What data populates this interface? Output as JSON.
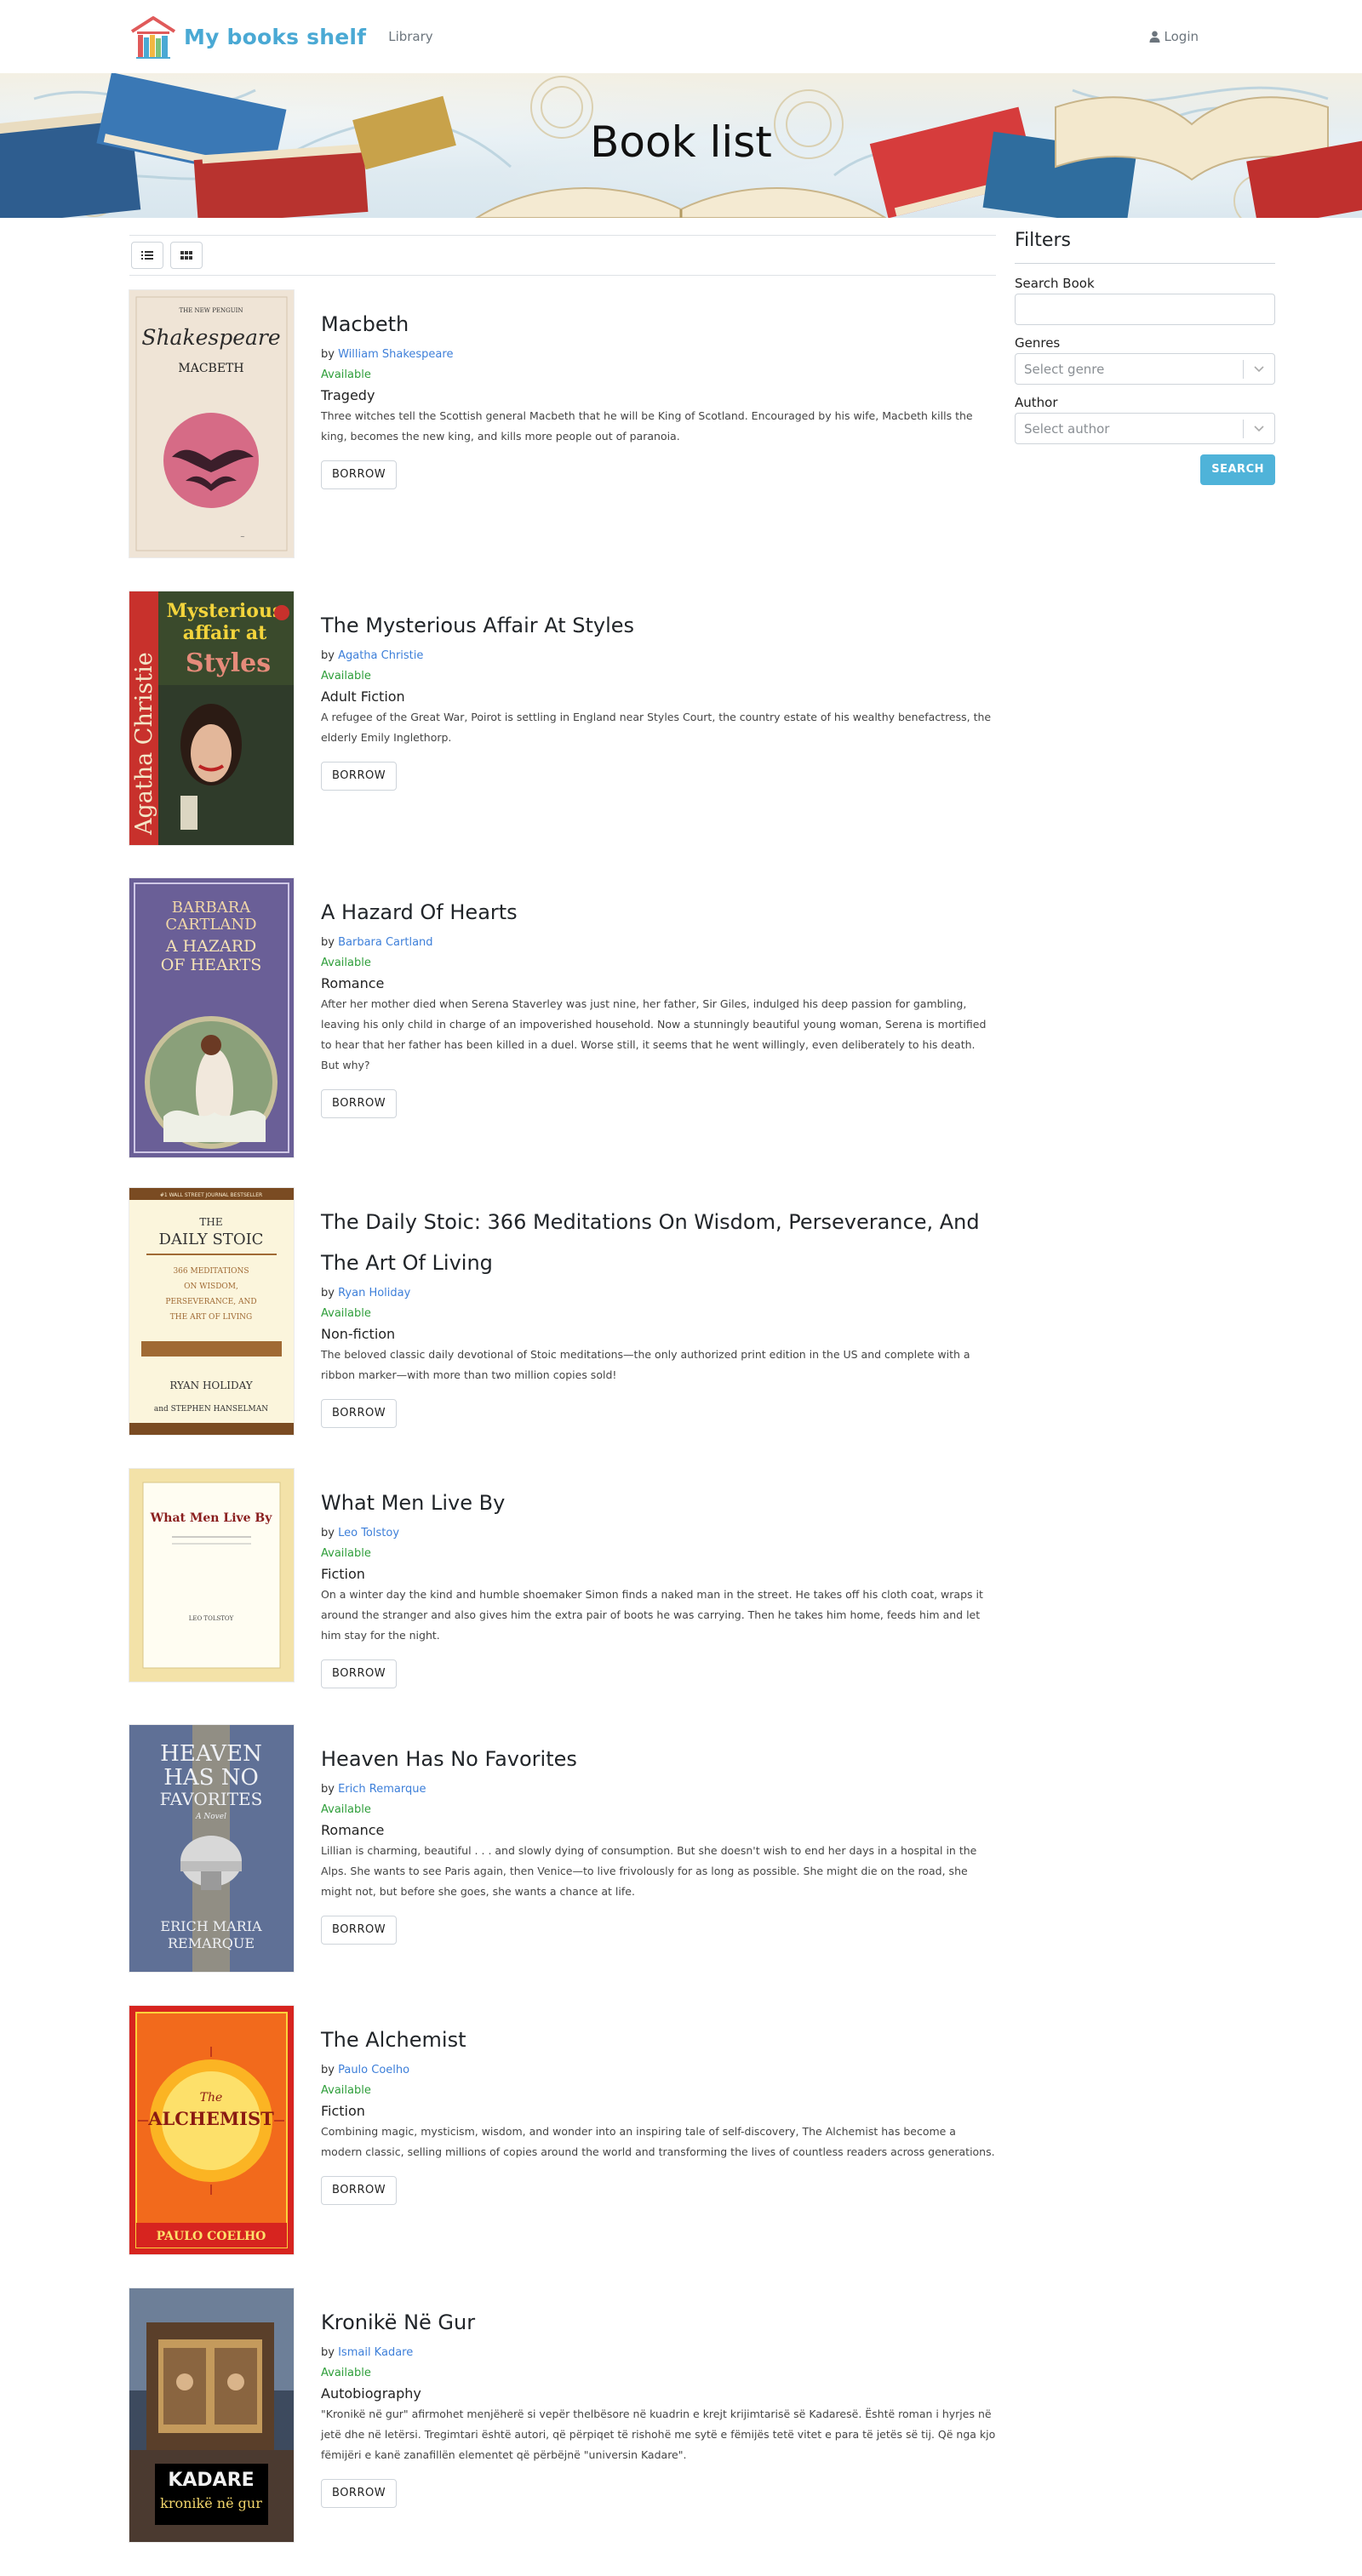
{
  "nav": {
    "brand": "My books shelf",
    "library": "Library",
    "login": "Login"
  },
  "hero": {
    "title": "Book list"
  },
  "sidebar": {
    "title": "Filters",
    "search_label": "Search Book",
    "genres_label": "Genres",
    "genre_placeholder": "Select genre",
    "author_label": "Author",
    "author_placeholder": "Select author",
    "search_button": "SEARCH"
  },
  "books": [
    {
      "title": "Macbeth",
      "by": "by",
      "author": "William Shakespeare",
      "status": "Available",
      "genre": "Tragedy",
      "description": "Three witches tell the Scottish general Macbeth that he will be King of Scotland. Encouraged by his wife, Macbeth kills the king, becomes the new king, and kills more people out of paranoia.",
      "borrow": "BORROW",
      "cover_text": [
        "THE NEW PENGUIN",
        "Shakespeare",
        "MACBETH"
      ]
    },
    {
      "title": "The Mysterious Affair At Styles",
      "by": "by",
      "author": "Agatha Christie",
      "status": "Available",
      "genre": "Adult Fiction",
      "description": "A refugee of the Great War, Poirot is settling in England near Styles Court, the country estate of his wealthy benefactress, the elderly Emily Inglethorp.",
      "borrow": "BORROW",
      "cover_text": [
        "Agatha Christie",
        "Mysterious",
        "affair at",
        "Styles"
      ]
    },
    {
      "title": "A Hazard Of Hearts",
      "by": "by",
      "author": "Barbara Cartland",
      "status": "Available",
      "genre": "Romance",
      "description": "After her mother died when Serena Staverley was just nine, her father, Sir Giles, indulged his deep passion for gambling, leaving his only child in charge of an impoverished household. Now a stunningly beautiful young woman, Serena is mortified to hear that her father has been killed in a duel. Worse still, it seems that he went willingly, even deliberately to his death. But why?",
      "borrow": "BORROW",
      "cover_text": [
        "BARBARA",
        "CARTLAND",
        "A HAZARD",
        "OF HEARTS"
      ]
    },
    {
      "title": "The Daily Stoic: 366 Meditations On Wisdom, Perseverance, And The Art Of Living",
      "by": "by",
      "author": "Ryan Holiday",
      "status": "Available",
      "genre": "Non-fiction",
      "description": "The beloved classic daily devotional of Stoic meditations—the only authorized print edition in the US and complete with a ribbon marker—with more than two million copies sold!",
      "borrow": "BORROW",
      "cover_text": [
        "#1 WALL STREET JOURNAL BESTSELLER",
        "THE",
        "DAILY STOIC",
        "366 MEDITATIONS",
        "ON WISDOM,",
        "PERSEVERANCE, AND",
        "THE ART OF LIVING",
        "RYAN HOLIDAY",
        "and STEPHEN HANSELMAN"
      ]
    },
    {
      "title": "What Men Live By",
      "by": "by",
      "author": "Leo Tolstoy",
      "status": "Available",
      "genre": "Fiction",
      "description": "On a winter day the kind and humble shoemaker Simon finds a naked man in the street. He takes off his cloth coat, wraps it around the stranger and also gives him the extra pair of boots he was carrying. Then he takes him home, feeds him and let him stay for the night.",
      "borrow": "BORROW",
      "cover_text": [
        "What Men Live By",
        "LEO TOLSTOY"
      ]
    },
    {
      "title": "Heaven Has No Favorites",
      "by": "by",
      "author": "Erich Remarque",
      "status": "Available",
      "genre": "Romance",
      "description": "Lillian is charming, beautiful . . . and slowly dying of consumption. But she doesn't wish to end her days in a hospital in the Alps. She wants to see Paris again, then Venice—to live frivolously for as long as possible. She might die on the road, she might not, but before she goes, she wants a chance at life.",
      "borrow": "BORROW",
      "cover_text": [
        "HEAVEN",
        "HAS NO",
        "FAVORITES",
        "A Novel",
        "ERICH MARIA",
        "REMARQUE"
      ]
    },
    {
      "title": "The Alchemist",
      "by": "by",
      "author": "Paulo Coelho",
      "status": "Available",
      "genre": "Fiction",
      "description": "Combining magic, mysticism, wisdom, and wonder into an inspiring tale of self-discovery, The Alchemist has become a modern classic, selling millions of copies around the world and transforming the lives of countless readers across generations.",
      "borrow": "BORROW",
      "cover_text": [
        "The",
        "ALCHEMIST",
        "PAULO COELHO"
      ]
    },
    {
      "title": "Kronikë Në Gur",
      "by": "by",
      "author": "Ismail Kadare",
      "status": "Available",
      "genre": "Autobiography",
      "description": "\"Kronikë në gur\" afirmohet menjëherë si vepër thelbësore në kuadrin e krejt krijimtarisë së Kadaresë. Është roman i hyrjes në jetë dhe në letërsi. Tregimtari është autori, që përpiqet të rishohë me sytë e fëmijës tetë vitet e para të jetës së tij. Që nga kjo fëmijëri e kanë zanafillën elementet që përbëjnë \"universin Kadare\".",
      "borrow": "BORROW",
      "cover_text": [
        "KADARE",
        "kronikë në gur"
      ]
    }
  ],
  "colors": {
    "brand": "#4aa9d4",
    "author_link": "#3d7fd9",
    "available": "#2e9e3a",
    "search_button": "#4fb3d9"
  },
  "icons": [
    "logo-books-icon",
    "user-icon",
    "list-view-icon",
    "grid-view-icon",
    "chevron-down-icon"
  ]
}
